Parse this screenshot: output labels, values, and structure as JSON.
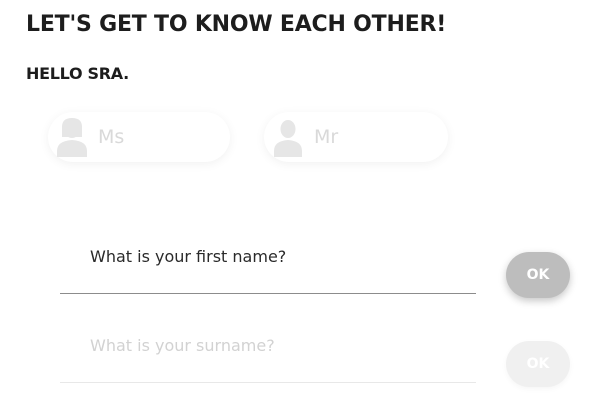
{
  "header": {
    "title": "LET'S GET TO KNOW EACH OTHER!",
    "greeting": "HELLO SRA."
  },
  "gender": {
    "options": [
      {
        "label": "Ms",
        "icon": "female-person-icon"
      },
      {
        "label": "Mr",
        "icon": "male-person-icon"
      }
    ]
  },
  "form": {
    "first_name": {
      "placeholder": "What is your first name?",
      "value": "",
      "ok_label": "OK"
    },
    "surname": {
      "placeholder": "What is your surname?",
      "value": "",
      "ok_label": "OK"
    }
  },
  "colors": {
    "text": "#1d1d1d",
    "muted_text": "#d9d9d9",
    "icon": "#e6e6e6",
    "ok_active": "#bdbdbd",
    "ok_disabled": "#f0f0f0",
    "underline_active": "#8c8c8c",
    "underline_inactive": "#e8e8e8"
  }
}
